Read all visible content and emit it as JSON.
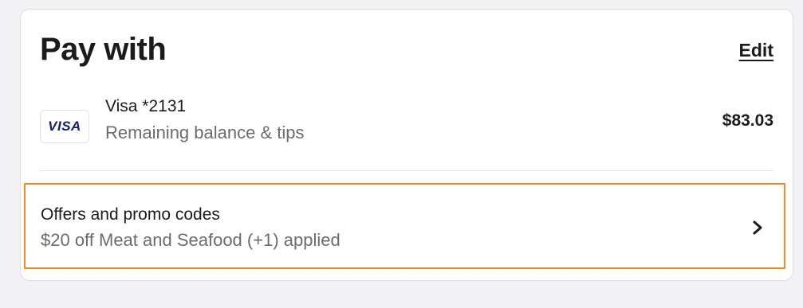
{
  "pay_section": {
    "title": "Pay with",
    "edit_label": "Edit"
  },
  "payment_method": {
    "brand_logo_text": "VISA",
    "name": "Visa *2131",
    "description": "Remaining balance & tips",
    "amount": "$83.03"
  },
  "offers": {
    "title": "Offers and promo codes",
    "description": "$20 off Meat and Seafood (+1) applied",
    "icon": "chevron-right-icon"
  },
  "colors": {
    "visa_brand": "#1a1f71",
    "highlight_border": "#f28b20"
  }
}
